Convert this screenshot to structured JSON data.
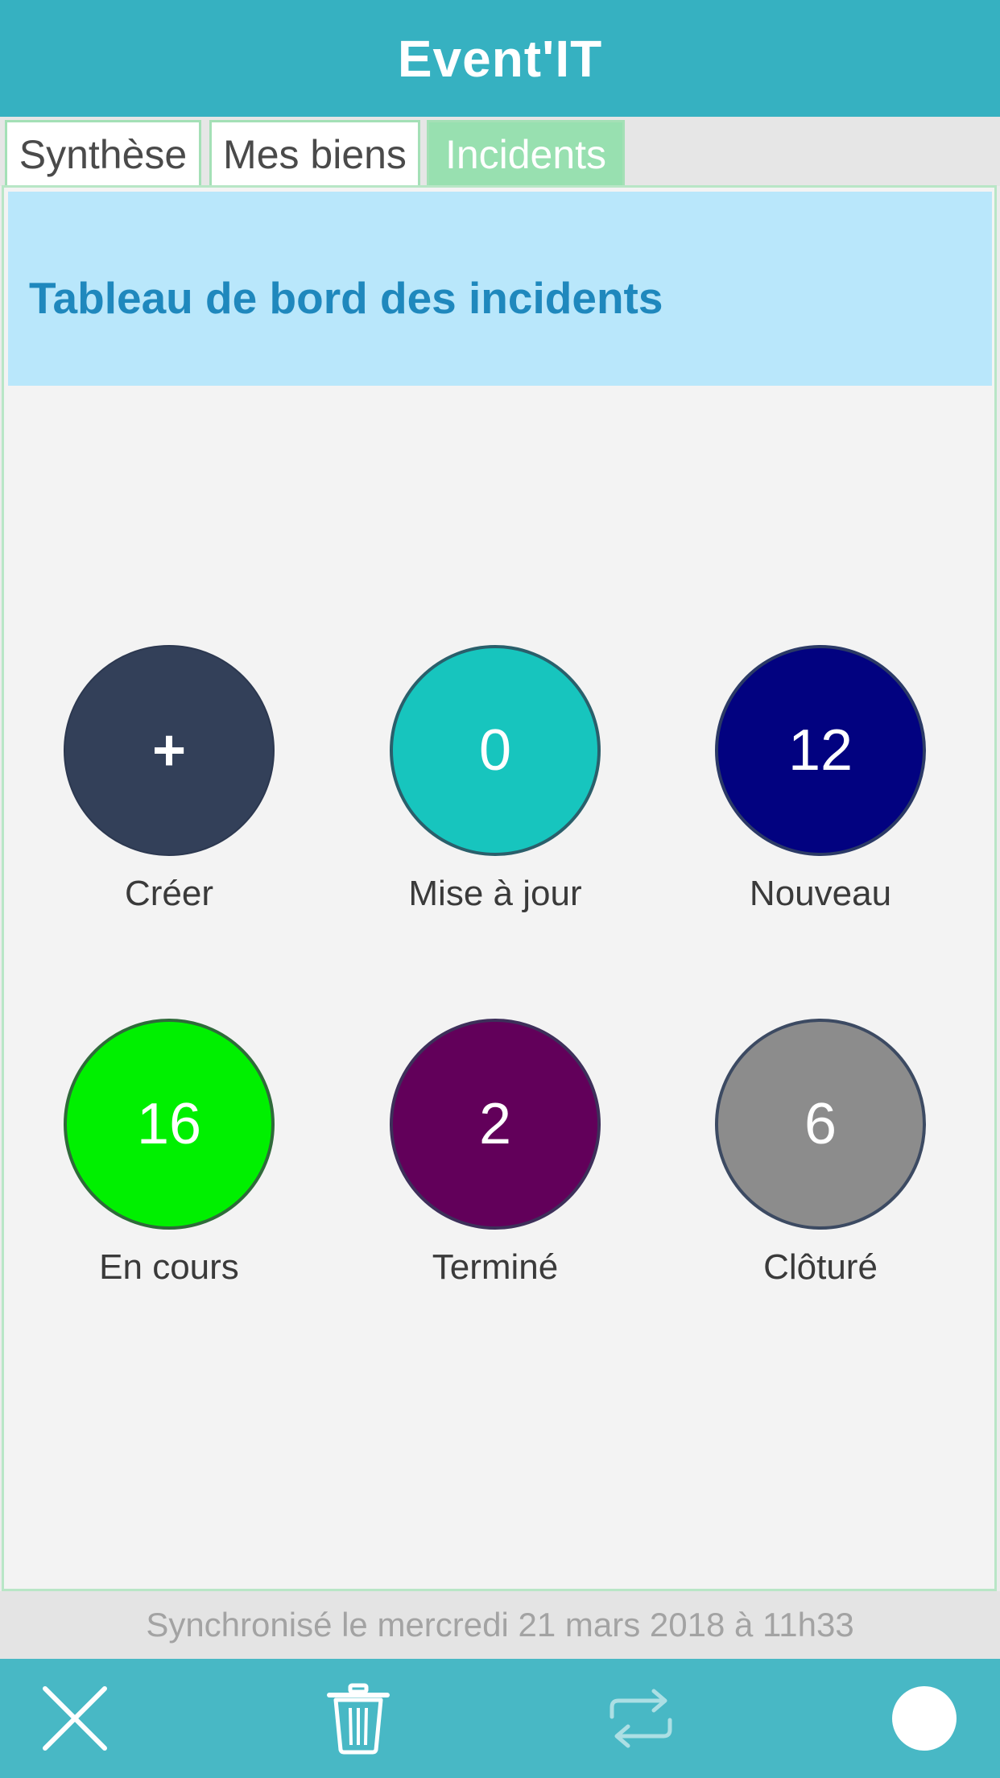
{
  "header": {
    "title": "Event'IT"
  },
  "tabs": [
    {
      "label": "Synthèse"
    },
    {
      "label": "Mes biens"
    },
    {
      "label": "Incidents"
    }
  ],
  "dashboard": {
    "title": "Tableau de bord des incidents",
    "tiles": [
      {
        "value": "+",
        "label": "Créer",
        "color": "#334059"
      },
      {
        "value": "0",
        "label": "Mise à jour",
        "color": "#17c5be"
      },
      {
        "value": "12",
        "label": "Nouveau",
        "color": "#020280"
      },
      {
        "value": "16",
        "label": "En cours",
        "color": "#00f000"
      },
      {
        "value": "2",
        "label": "Terminé",
        "color": "#62005a"
      },
      {
        "value": "6",
        "label": "Clôturé",
        "color": "#8c8c8c"
      }
    ]
  },
  "sync": {
    "text": "Synchronisé le mercredi 21 mars 2018 à 11h33"
  },
  "toolbar": {
    "icons": [
      "close-icon",
      "trash-icon",
      "sync-icon",
      "circle-icon"
    ]
  }
}
